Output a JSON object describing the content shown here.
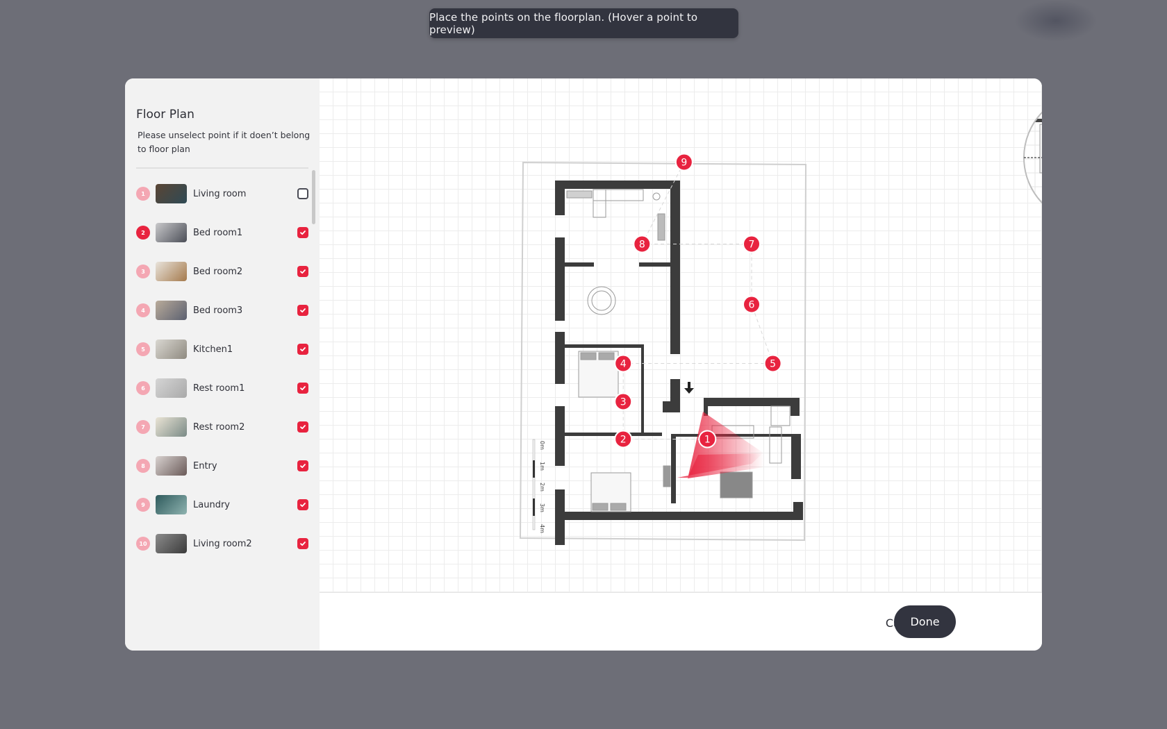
{
  "tooltip": {
    "text": "Place the points on the floorplan. (Hover a point to preview)"
  },
  "sidebar": {
    "title": "Floor Plan",
    "description": "Please unselect point if it doen’t belong to floor plan",
    "items": [
      {
        "number": "1",
        "label": "Living room",
        "checked": false,
        "active": false,
        "thumb_colors": [
          "#5a4534",
          "#2f4a55"
        ]
      },
      {
        "number": "2",
        "label": "Bed room1",
        "checked": true,
        "active": true,
        "thumb_colors": [
          "#c9c9cb",
          "#4b4e57"
        ]
      },
      {
        "number": "3",
        "label": "Bed room2",
        "checked": true,
        "active": false,
        "thumb_colors": [
          "#e8e3dc",
          "#a57a4c"
        ]
      },
      {
        "number": "4",
        "label": "Bed room3",
        "checked": true,
        "active": false,
        "thumb_colors": [
          "#b9ab9a",
          "#5b6070"
        ]
      },
      {
        "number": "5",
        "label": "Kitchen1",
        "checked": true,
        "active": false,
        "thumb_colors": [
          "#d9d7d1",
          "#8f8a80"
        ]
      },
      {
        "number": "6",
        "label": "Rest room1",
        "checked": true,
        "active": false,
        "thumb_colors": [
          "#d5d5d5",
          "#a9a9a9"
        ]
      },
      {
        "number": "7",
        "label": "Rest room2",
        "checked": true,
        "active": false,
        "thumb_colors": [
          "#eae4d5",
          "#7a8a86"
        ]
      },
      {
        "number": "8",
        "label": "Entry",
        "checked": true,
        "active": false,
        "thumb_colors": [
          "#d8d2d0",
          "#6a5a58"
        ]
      },
      {
        "number": "9",
        "label": "Laundry",
        "checked": true,
        "active": false,
        "thumb_colors": [
          "#2e5a5c",
          "#8fb3b0"
        ]
      },
      {
        "number": "10",
        "label": "Living room2",
        "checked": true,
        "active": false,
        "thumb_colors": [
          "#8b8b8b",
          "#3b3b3b"
        ]
      }
    ]
  },
  "floorplan": {
    "points": [
      {
        "number": "1",
        "x": 0.623,
        "y": 0.745
      },
      {
        "number": "2",
        "x": 0.279,
        "y": 0.745
      },
      {
        "number": "3",
        "x": 0.279,
        "y": 0.637
      },
      {
        "number": "4",
        "x": 0.279,
        "y": 0.527
      },
      {
        "number": "5",
        "x": 0.891,
        "y": 0.527
      },
      {
        "number": "6",
        "x": 0.804,
        "y": 0.357
      },
      {
        "number": "7",
        "x": 0.804,
        "y": 0.183
      },
      {
        "number": "8",
        "x": 0.356,
        "y": 0.183
      },
      {
        "number": "9",
        "x": 0.528,
        "y": -0.053
      }
    ],
    "scale_labels": [
      "0m",
      "1m",
      "2m",
      "3m",
      "4m"
    ],
    "accent_color": "#e8233f"
  },
  "footer": {
    "cancel_label": "Cancel",
    "done_label": "Done"
  }
}
